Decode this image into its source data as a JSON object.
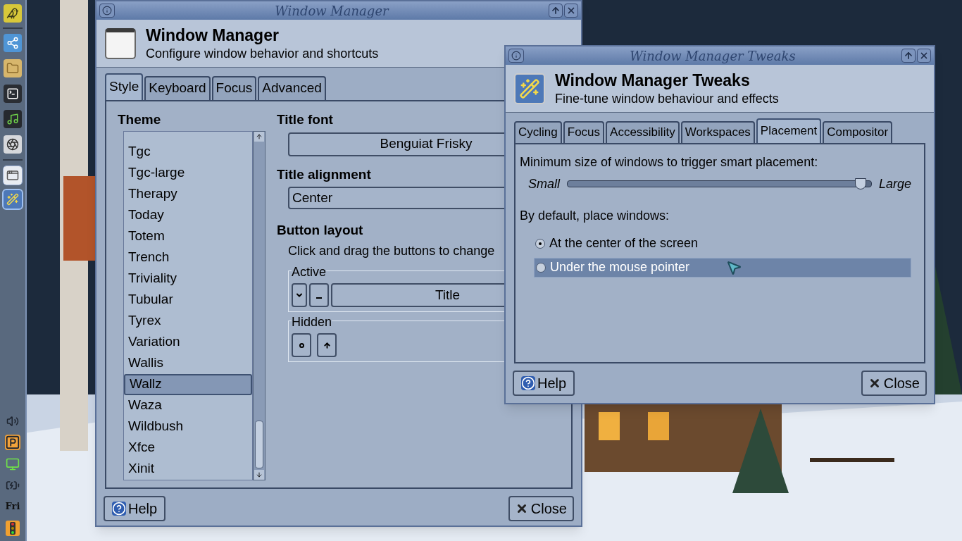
{
  "dock": {
    "day": "Fri"
  },
  "window_manager": {
    "title": "Window Manager",
    "heading": "Window Manager",
    "subheading": "Configure window behavior and shortcuts",
    "tabs": [
      {
        "label": "Style",
        "selected": true
      },
      {
        "label": "Keyboard",
        "selected": false
      },
      {
        "label": "Focus",
        "selected": false
      },
      {
        "label": "Advanced",
        "selected": false
      }
    ],
    "theme": {
      "label": "Theme",
      "items": [
        {
          "label": "Tgc",
          "selected": false
        },
        {
          "label": "Tgc-large",
          "selected": false
        },
        {
          "label": "Therapy",
          "selected": false
        },
        {
          "label": "Today",
          "selected": false
        },
        {
          "label": "Totem",
          "selected": false
        },
        {
          "label": "Trench",
          "selected": false
        },
        {
          "label": "Triviality",
          "selected": false
        },
        {
          "label": "Tubular",
          "selected": false
        },
        {
          "label": "Tyrex",
          "selected": false
        },
        {
          "label": "Variation",
          "selected": false
        },
        {
          "label": "Wallis",
          "selected": false
        },
        {
          "label": "Wallz",
          "selected": true
        },
        {
          "label": "Waza",
          "selected": false
        },
        {
          "label": "Wildbush",
          "selected": false
        },
        {
          "label": "Xfce",
          "selected": false
        },
        {
          "label": "Xinit",
          "selected": false
        }
      ]
    },
    "title_font": {
      "label": "Title font",
      "value": "Benguiat Frisky"
    },
    "title_alignment": {
      "label": "Title alignment",
      "value": "Center"
    },
    "button_layout": {
      "label": "Button layout",
      "hint": "Click and drag the buttons to change",
      "active": {
        "label": "Active",
        "title": "Title"
      },
      "hidden": {
        "label": "Hidden"
      }
    },
    "help": "Help",
    "close": "Close"
  },
  "tweaks": {
    "title": "Window Manager Tweaks",
    "heading": "Window Manager Tweaks",
    "subheading": "Fine-tune window behaviour and effects",
    "tabs": [
      {
        "label": "Cycling",
        "selected": false
      },
      {
        "label": "Focus",
        "selected": false
      },
      {
        "label": "Accessibility",
        "selected": false
      },
      {
        "label": "Workspaces",
        "selected": false
      },
      {
        "label": "Placement",
        "selected": true
      },
      {
        "label": "Compositor",
        "selected": false
      }
    ],
    "placement": {
      "size_label": "Minimum size of windows to trigger smart placement:",
      "min_label": "Small",
      "max_label": "Large",
      "level": 0.98,
      "default_label": "By default, place windows:",
      "options": [
        {
          "label": "At the center of the screen",
          "selected": true,
          "highlighted": false
        },
        {
          "label": "Under the mouse pointer",
          "selected": false,
          "highlighted": true
        }
      ]
    },
    "help": "Help",
    "close": "Close"
  }
}
